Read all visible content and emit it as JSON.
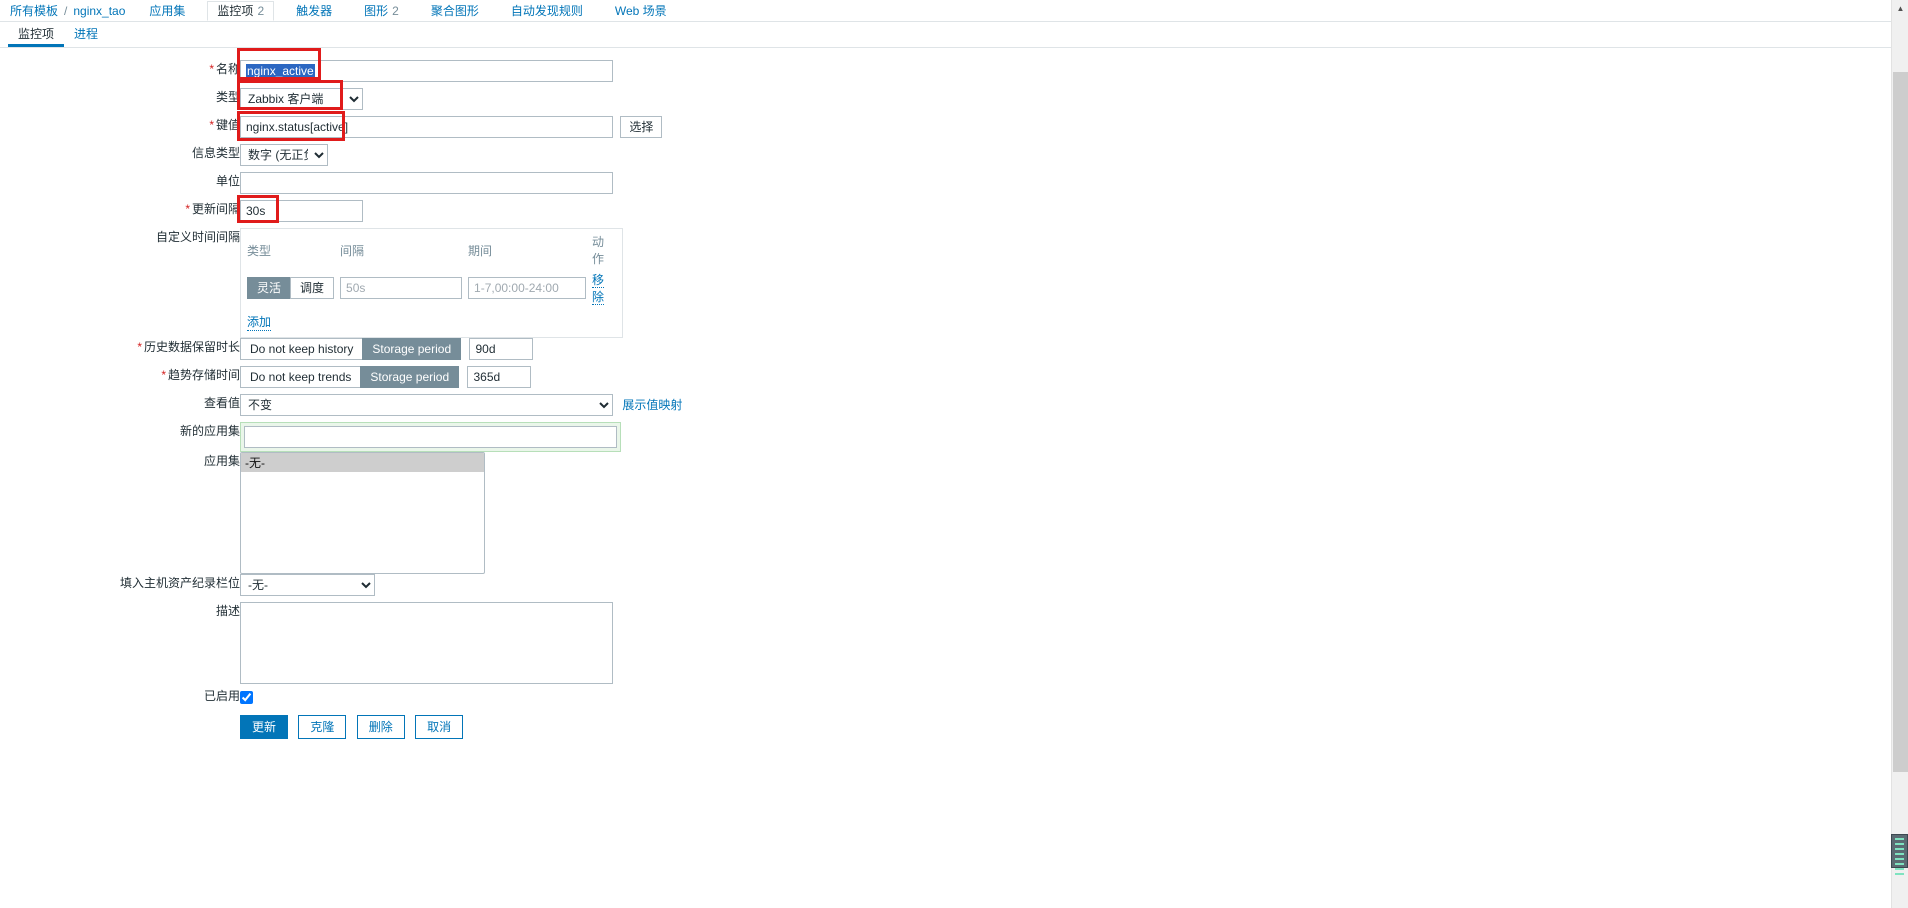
{
  "breadcrumb": {
    "all_templates": "所有模板",
    "separator": "/",
    "host": "nginx_tao"
  },
  "nav": {
    "items": [
      {
        "label": "应用集",
        "count": "",
        "selected": false
      },
      {
        "label": "监控项",
        "count": "2",
        "selected": true
      },
      {
        "label": "触发器",
        "count": "",
        "selected": false
      },
      {
        "label": "图形",
        "count": "2",
        "selected": false
      },
      {
        "label": "聚合图形",
        "count": "",
        "selected": false
      },
      {
        "label": "自动发现规则",
        "count": "",
        "selected": false
      },
      {
        "label": "Web 场景",
        "count": "",
        "selected": false
      }
    ]
  },
  "subtabs": [
    {
      "label": "监控项",
      "active": true
    },
    {
      "label": "进程",
      "active": false
    }
  ],
  "form": {
    "name": {
      "label": "名称",
      "value": "nginx_active",
      "required": true
    },
    "type": {
      "label": "类型",
      "value": "Zabbix 客户端",
      "required": false
    },
    "key": {
      "label": "键值",
      "value": "nginx.status[active]",
      "required": true,
      "select_button": "选择"
    },
    "value_type": {
      "label": "信息类型",
      "value": "数字 (无正负)"
    },
    "units": {
      "label": "单位",
      "value": ""
    },
    "update_interval": {
      "label": "更新间隔",
      "value": "30s",
      "required": true
    },
    "custom_intervals": {
      "label": "自定义时间间隔",
      "headers": {
        "type": "类型",
        "interval": "间隔",
        "period": "期间",
        "action": "动作"
      },
      "rows": [
        {
          "type_options": [
            "灵活",
            "调度"
          ],
          "type_selected": "灵活",
          "interval_value": "",
          "interval_placeholder": "50s",
          "period_value": "",
          "period_placeholder": "1-7,00:00-24:00",
          "remove_label": "移除"
        }
      ],
      "add_label": "添加"
    },
    "history": {
      "label": "历史数据保留时长",
      "required": true,
      "options": [
        "Do not keep history",
        "Storage period"
      ],
      "selected": "Storage period",
      "value": "90d"
    },
    "trends": {
      "label": "趋势存储时间",
      "required": true,
      "options": [
        "Do not keep trends",
        "Storage period"
      ],
      "selected": "Storage period",
      "value": "365d"
    },
    "show_value": {
      "label": "查看值",
      "value": "不变",
      "link_label": "展示值映射"
    },
    "new_application": {
      "label": "新的应用集",
      "value": ""
    },
    "applications": {
      "label": "应用集",
      "options": [
        "-无-"
      ],
      "selected": "-无-"
    },
    "host_inventory_field": {
      "label": "填入主机资产纪录栏位",
      "value": "-无-"
    },
    "description": {
      "label": "描述",
      "value": ""
    },
    "enabled": {
      "label": "已启用",
      "checked": true
    }
  },
  "buttons": {
    "update": "更新",
    "clone": "克隆",
    "delete": "删除",
    "cancel": "取消"
  },
  "scrollbar": {
    "up_arrow": "▲",
    "down_arrow": "▼"
  }
}
